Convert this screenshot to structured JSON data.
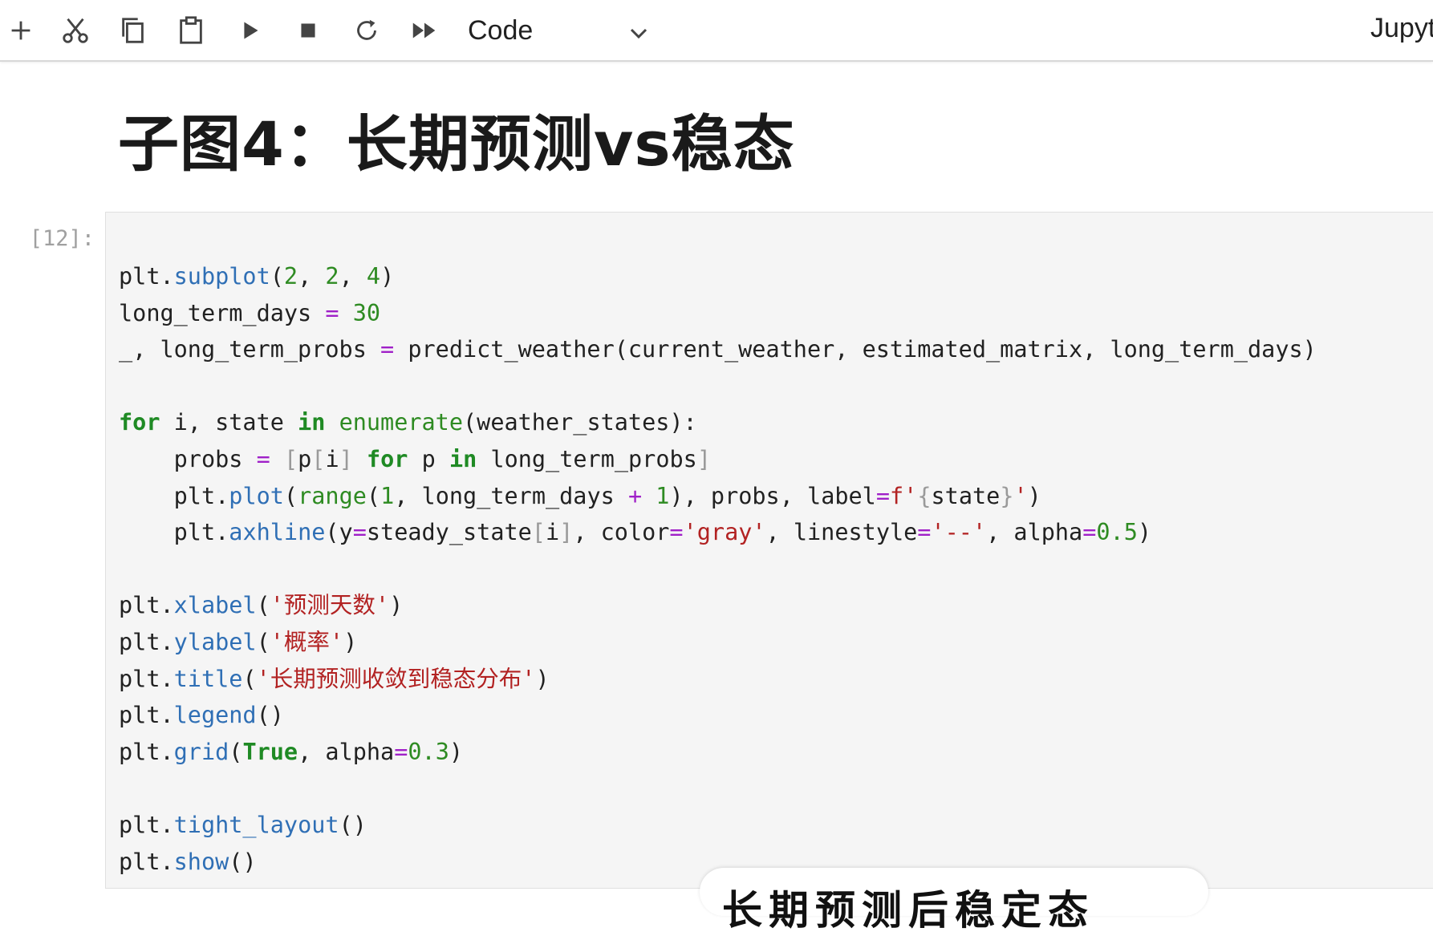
{
  "toolbar": {
    "buttons": [
      {
        "name": "insert-cell-below-button",
        "icon": "plus-icon",
        "glyph": "+"
      },
      {
        "name": "cut-cells-button",
        "icon": "scissors-icon"
      },
      {
        "name": "copy-cells-button",
        "icon": "copy-icon"
      },
      {
        "name": "paste-cells-button",
        "icon": "paste-icon"
      },
      {
        "name": "run-cell-button",
        "icon": "play-icon"
      },
      {
        "name": "interrupt-kernel-button",
        "icon": "stop-icon"
      },
      {
        "name": "restart-kernel-button",
        "icon": "refresh-icon"
      },
      {
        "name": "restart-run-all-button",
        "icon": "fast-forward-icon"
      }
    ],
    "cell_type": "Code",
    "kernel_label": "Jupyt"
  },
  "heading": "子图4：长期预测vs稳态",
  "cell": {
    "prompt": "[12]:",
    "lines": [
      "",
      "plt.subplot(2, 2, 4)",
      "long_term_days = 30",
      "_, long_term_probs = predict_weather(current_weather, estimated_matrix, long_term_days)",
      "",
      "for i, state in enumerate(weather_states):",
      "    probs = [p[i] for p in long_term_probs]",
      "    plt.plot(range(1, long_term_days + 1), probs, label=f'{state}')",
      "    plt.axhline(y=steady_state[i], color='gray', linestyle='--', alpha=0.5)",
      "",
      "plt.xlabel('预测天数')",
      "plt.ylabel('概率')",
      "plt.title('长期预测收敛到稳态分布')",
      "plt.legend()",
      "plt.grid(True, alpha=0.3)",
      "",
      "plt.tight_layout()",
      "plt.show()"
    ]
  },
  "subtitle": "长期预测后稳定态",
  "colors": {
    "function": "#2f6fb5",
    "number": "#2e8b22",
    "keyword": "#1f8a24",
    "string": "#b22222",
    "operator": "#a020c8",
    "cell_bg": "#f5f5f5"
  }
}
